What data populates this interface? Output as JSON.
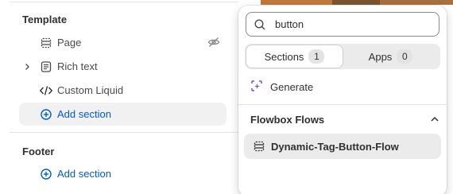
{
  "sidebar": {
    "template_heading": "Template",
    "template_items": [
      {
        "label": "Page",
        "icon": "page-layout-icon"
      },
      {
        "label": "Rich text",
        "icon": "text-block-icon"
      },
      {
        "label": "Custom Liquid",
        "icon": "code-icon"
      }
    ],
    "template_add": "Add section",
    "footer_heading": "Footer",
    "footer_add": "Add section"
  },
  "popover": {
    "search": {
      "value": "button",
      "placeholder": ""
    },
    "tabs": [
      {
        "label": "Sections",
        "count": "1",
        "active": true
      },
      {
        "label": "Apps",
        "count": "0",
        "active": false
      }
    ],
    "generate_label": "Generate",
    "group": {
      "title": "Flowbox Flows",
      "items": [
        {
          "label": "Dynamic-Tag-Button-Flow"
        }
      ]
    }
  },
  "colors": {
    "accent_blue": "#005bd3",
    "generate_purple": "#7b4ddb",
    "highlight": "#ebebeb"
  }
}
